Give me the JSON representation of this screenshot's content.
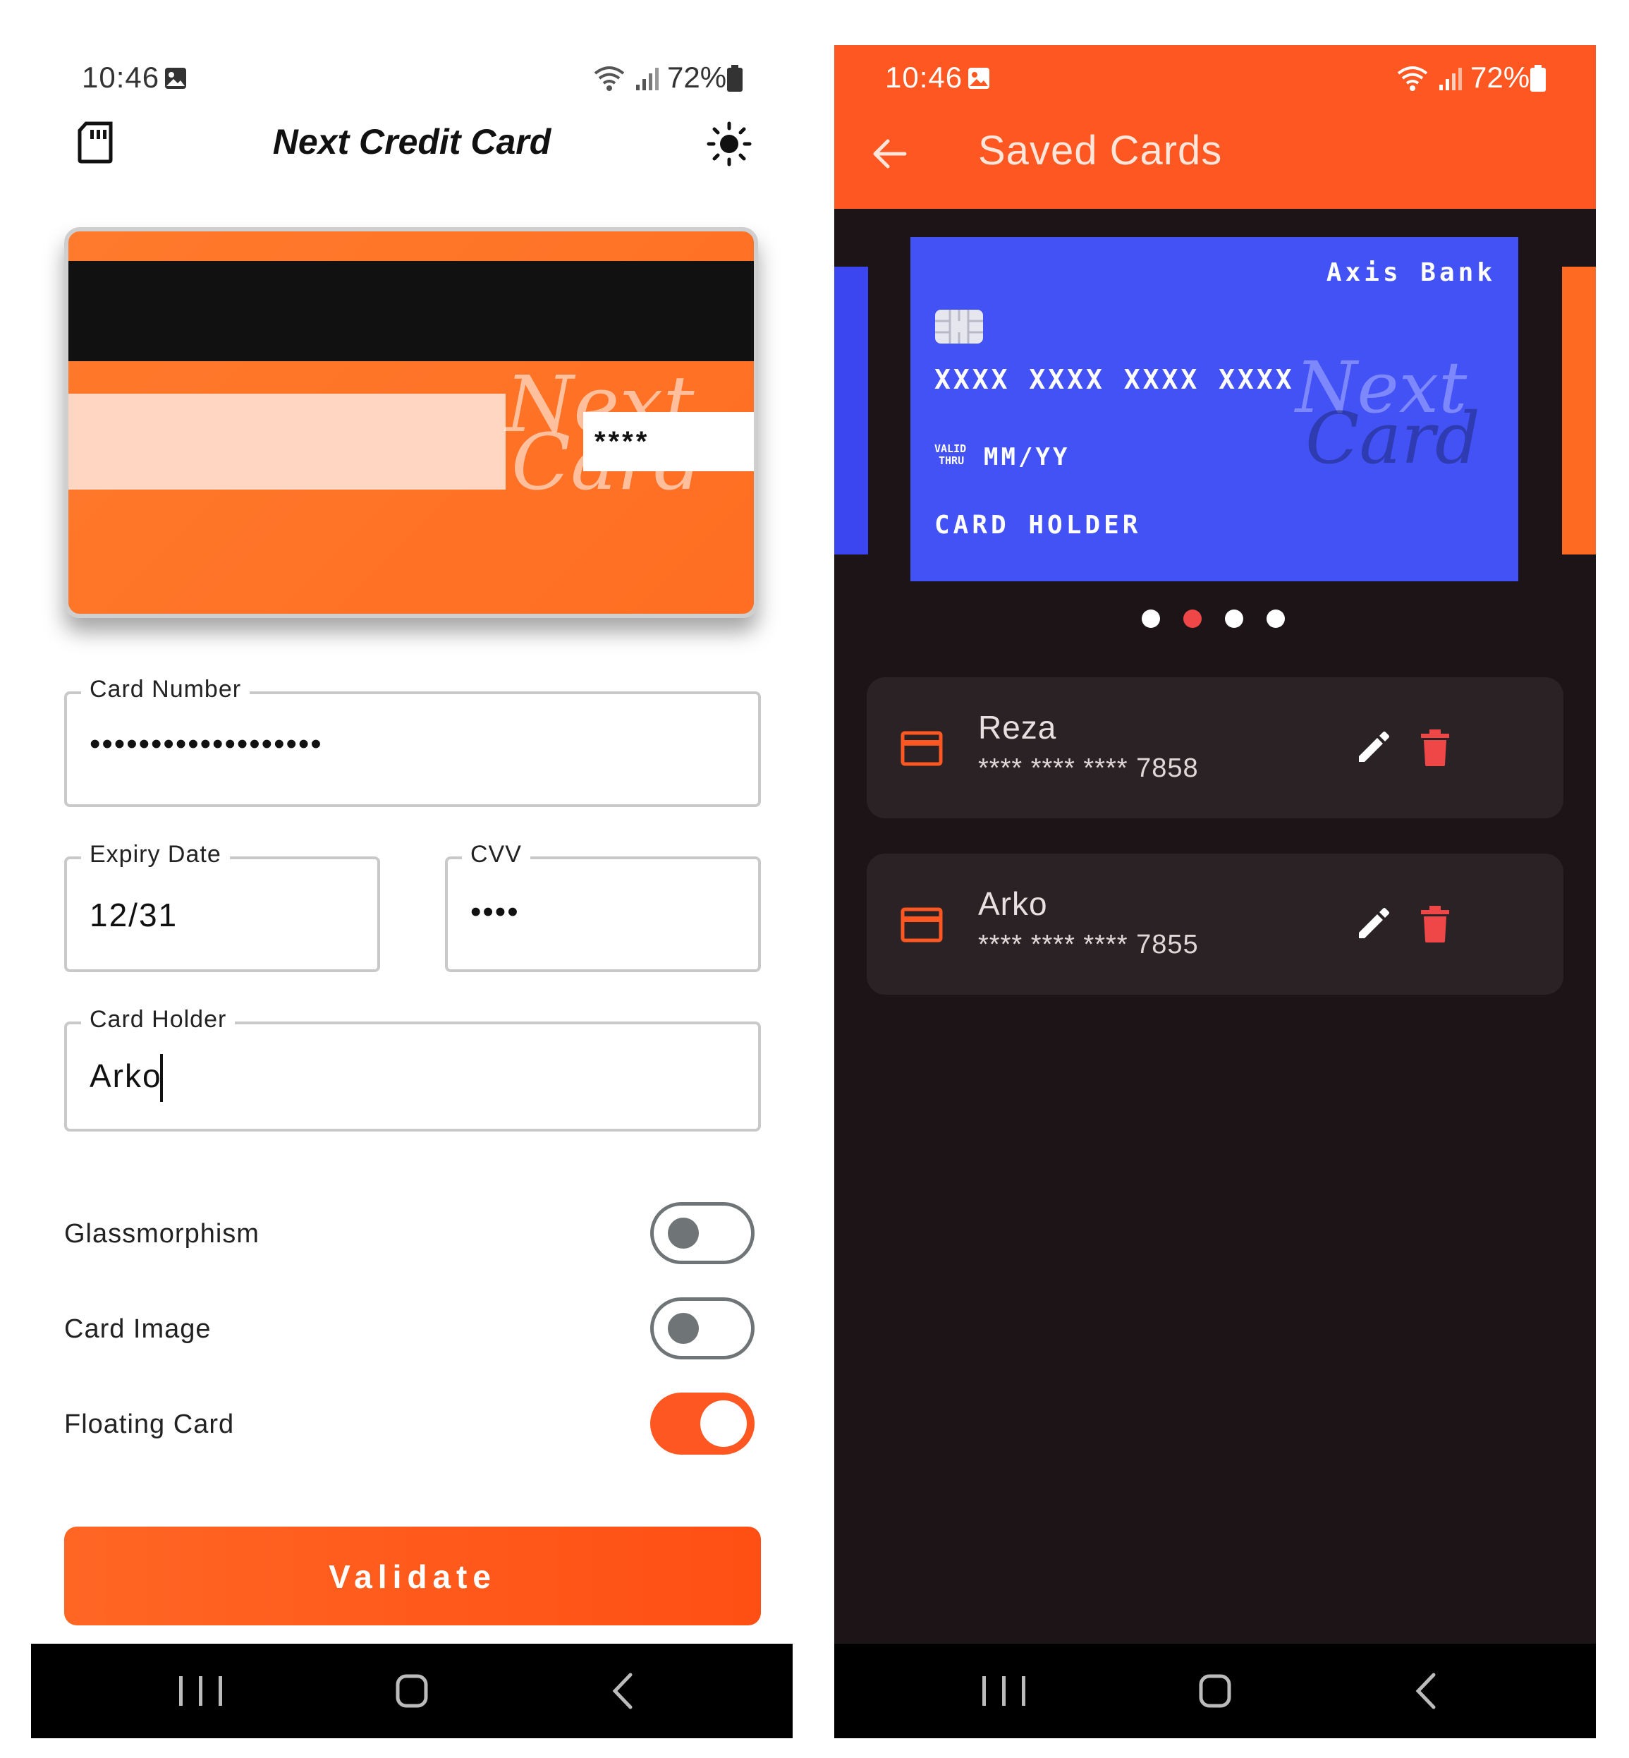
{
  "left_screen": {
    "status": {
      "time": "10:46",
      "battery": "72%"
    },
    "app_title": "Next Credit Card",
    "card_preview": {
      "cvv_mask": "****",
      "watermark_line1": "Next",
      "watermark_line2": "Card"
    },
    "fields": {
      "card_number": {
        "label": "Card Number",
        "value": "•••••••••••••••••••"
      },
      "expiry": {
        "label": "Expiry Date",
        "value": "12/31"
      },
      "cvv": {
        "label": "CVV",
        "value": "••••"
      },
      "holder": {
        "label": "Card Holder",
        "value": "Arko"
      }
    },
    "toggles": [
      {
        "label": "Glassmorphism",
        "on": false
      },
      {
        "label": "Card Image",
        "on": false
      },
      {
        "label": "Floating Card",
        "on": true
      }
    ],
    "validate_label": "Validate"
  },
  "right_screen": {
    "status": {
      "time": "10:46",
      "battery": "72%"
    },
    "app_title": "Saved Cards",
    "carousel_card": {
      "bank": "Axis Bank",
      "number": "XXXX XXXX XXXX XXXX",
      "valid_line1": "VALID",
      "valid_line2": "THRU",
      "expiry": "MM/YY",
      "holder": "CARD HOLDER",
      "watermark_line1": "Next",
      "watermark_line2": "Card",
      "color": "#4352f5"
    },
    "carousel_page": 2,
    "carousel_total": 4,
    "saved_cards": [
      {
        "name": "Reza",
        "number": "**** **** **** 7858"
      },
      {
        "name": "Arko",
        "number": "**** **** **** 7855"
      }
    ]
  },
  "colors": {
    "accent": "#ff5722",
    "dark_bg": "#1c1416",
    "delete": "#ef4747"
  }
}
